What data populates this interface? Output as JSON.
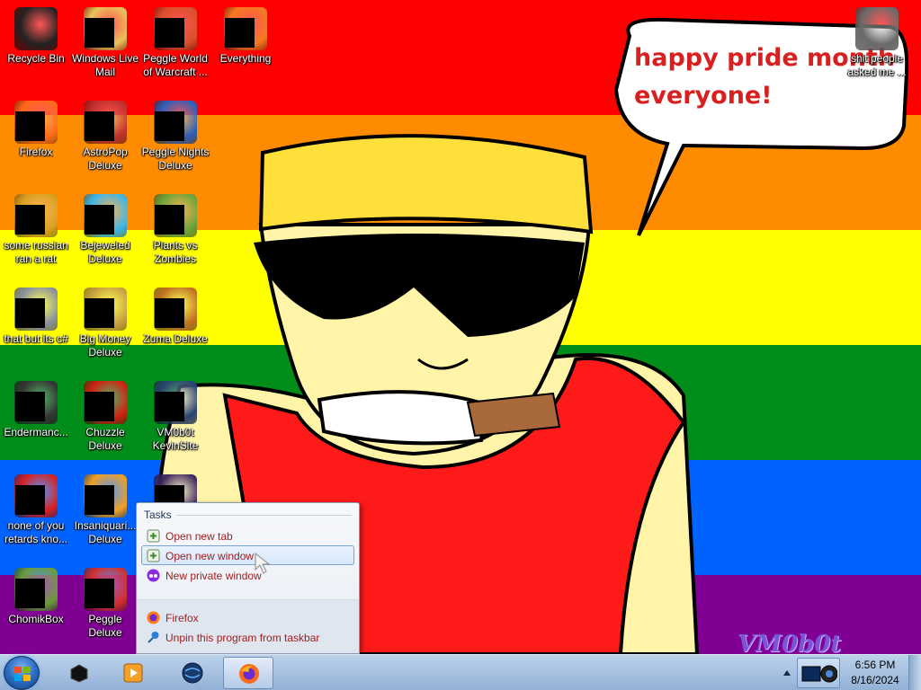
{
  "wallpaper": {
    "stripes": [
      "#ff0000",
      "#ff8c00",
      "#ffff00",
      "#008d1a",
      "#0062ff",
      "#800093"
    ],
    "speech_text": "happy pride month\neveryone!",
    "watermark": "VM0b0t"
  },
  "desktop_icons": [
    {
      "label": "Recycle Bin",
      "icon": "recycle-bin-icon",
      "color": "#222"
    },
    {
      "label": "Windows Live Mail",
      "icon": "mail-icon",
      "color": "#e8c35a"
    },
    {
      "label": "Peggle World of Warcraft ...",
      "icon": "peggle-wow-icon",
      "color": "#d9502a"
    },
    {
      "label": "Everything",
      "icon": "search-magnifier-icon",
      "color": "#f47a20"
    },
    {
      "label": "Firefox",
      "icon": "firefox-icon",
      "color": "#ff6a1a"
    },
    {
      "label": "AstroPop Deluxe",
      "icon": "astropop-icon",
      "color": "#c0302a"
    },
    {
      "label": "Peggle Nights Deluxe",
      "icon": "peggle-nights-icon",
      "color": "#2b5fb8"
    },
    {
      "label": "some russian ran a rat",
      "icon": "rat-app-icon",
      "color": "#d9a020"
    },
    {
      "label": "Bejeweled Deluxe",
      "icon": "bejeweled-icon",
      "color": "#3ab6e8"
    },
    {
      "label": "Plants vs Zombies",
      "icon": "plants-vs-zombies-icon",
      "color": "#6ba43a"
    },
    {
      "label": "that but its c#",
      "icon": "stacked-windows-icon",
      "color": "#8890a0"
    },
    {
      "label": "Big Money Deluxe",
      "icon": "money-bag-icon",
      "color": "#c8a040"
    },
    {
      "label": "Zuma Deluxe",
      "icon": "zuma-icon",
      "color": "#c07020"
    },
    {
      "label": "Endermanc...",
      "icon": "terminal-icon",
      "color": "#333"
    },
    {
      "label": "Chuzzle Deluxe",
      "icon": "chuzzle-icon",
      "color": "#d02010"
    },
    {
      "label": "VM0b0t KevinSite",
      "icon": "website-icon",
      "color": "#2a4470"
    },
    {
      "label": "none of you retards kno...",
      "icon": "opera-icon",
      "color": "#d62020"
    },
    {
      "label": "Insaniquari... Deluxe",
      "icon": "insaniquarium-icon",
      "color": "#f0a020"
    },
    {
      "label": "",
      "icon": "document-icon",
      "color": "#402860"
    },
    {
      "label": "ChomikBox",
      "icon": "chomikbox-icon",
      "color": "#6a9a3a"
    },
    {
      "label": "Peggle Deluxe",
      "icon": "peggle-icon",
      "color": "#d03030"
    },
    {
      "label": "shit people asked me ...",
      "icon": "folder-icon",
      "color": "#6a6a6a"
    }
  ],
  "jumplist": {
    "header": "Tasks",
    "tasks": [
      {
        "label": "Open new tab",
        "icon": "new-tab-icon"
      },
      {
        "label": "Open new window",
        "icon": "new-window-icon"
      },
      {
        "label": "New private window",
        "icon": "private-window-icon"
      }
    ],
    "app": {
      "label": "Firefox",
      "icon": "firefox-icon"
    },
    "unpin": {
      "label": "Unpin this program from taskbar",
      "icon": "unpin-icon"
    }
  },
  "taskbar": {
    "pinned": [
      {
        "name": "taskbar-app-recycle",
        "icon": "black-cube-icon"
      },
      {
        "name": "taskbar-app-media",
        "icon": "media-player-icon"
      },
      {
        "name": "taskbar-app-browser",
        "icon": "globe-icon"
      },
      {
        "name": "taskbar-app-firefox",
        "icon": "firefox-icon"
      }
    ],
    "clock": {
      "time": "6:56 PM",
      "date": "8/16/2024"
    }
  }
}
